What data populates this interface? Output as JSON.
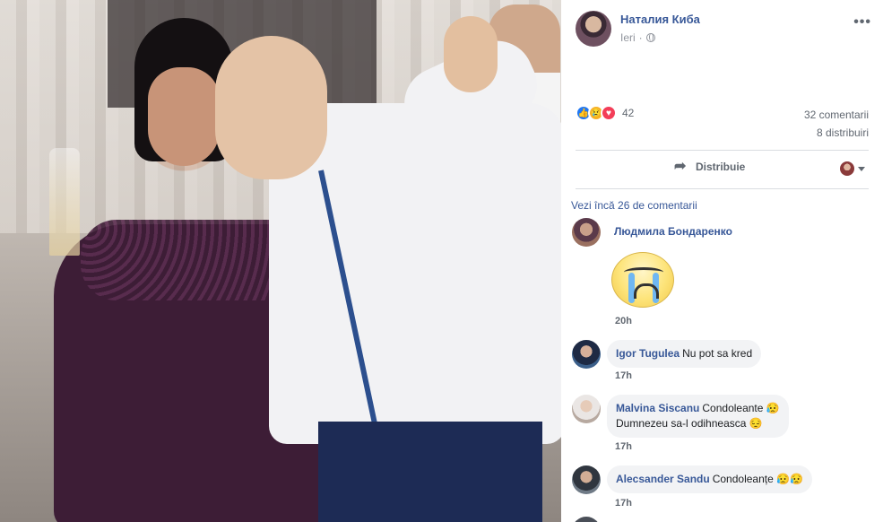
{
  "post": {
    "author": "Наталия Киба",
    "time": "Ieri",
    "more_label": "•••",
    "reactions": {
      "count": "42",
      "icons": [
        "like-icon",
        "sad-icon",
        "love-icon"
      ],
      "colors": {
        "like": "#2078f4",
        "sad": "#f7b125",
        "love": "#f33e58"
      }
    },
    "comments_count": "32 comentarii",
    "shares_count": "8 distribuiri",
    "share_label": "Distribuie"
  },
  "comments_section": {
    "view_more": "Vezi încă 26 de comentarii",
    "items": [
      {
        "name": "Людмила Бондаренко",
        "text": "",
        "time": "20h",
        "sticker": "crying-face-sticker"
      },
      {
        "name": "Igor Tugulea",
        "text": "Nu pot sa kred",
        "time": "17h"
      },
      {
        "name": "Malvina Siscanu",
        "text": "Condoleante 😥",
        "text2": "Dumnezeu sa-l odihneasca 😔",
        "time": "17h"
      },
      {
        "name": "Alecsander Sandu",
        "text": "Condoleanțe 😥😥",
        "time": "17h"
      }
    ]
  },
  "theme": {
    "link": "#385898",
    "muted": "#606770",
    "bubble": "#f2f3f5"
  }
}
